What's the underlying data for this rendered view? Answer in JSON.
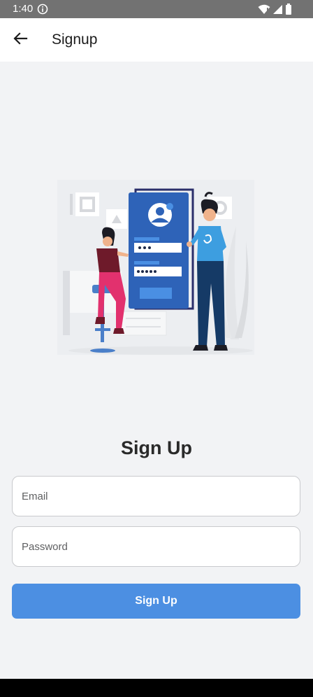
{
  "status_bar": {
    "time": "1:40",
    "icons": [
      "info-icon",
      "wifi-icon",
      "signal-icon",
      "battery-icon"
    ]
  },
  "app_bar": {
    "back_icon": "arrow-left-icon",
    "title": "Signup"
  },
  "illustration": {
    "description_icon": "signup-illustration",
    "colors": {
      "phone": "#2e63b8",
      "accent": "#4a8fe3",
      "woman_pants": "#e2316e",
      "woman_top": "#6e1a2a",
      "man_shirt": "#3d9ee0",
      "man_pants": "#153a66"
    }
  },
  "form": {
    "heading": "Sign Up",
    "email_placeholder": "Email",
    "password_placeholder": "Password",
    "submit_label": "Sign Up"
  },
  "colors": {
    "background": "#f2f3f5",
    "primary_button": "#4c8fe2",
    "status_bar": "#727272"
  }
}
